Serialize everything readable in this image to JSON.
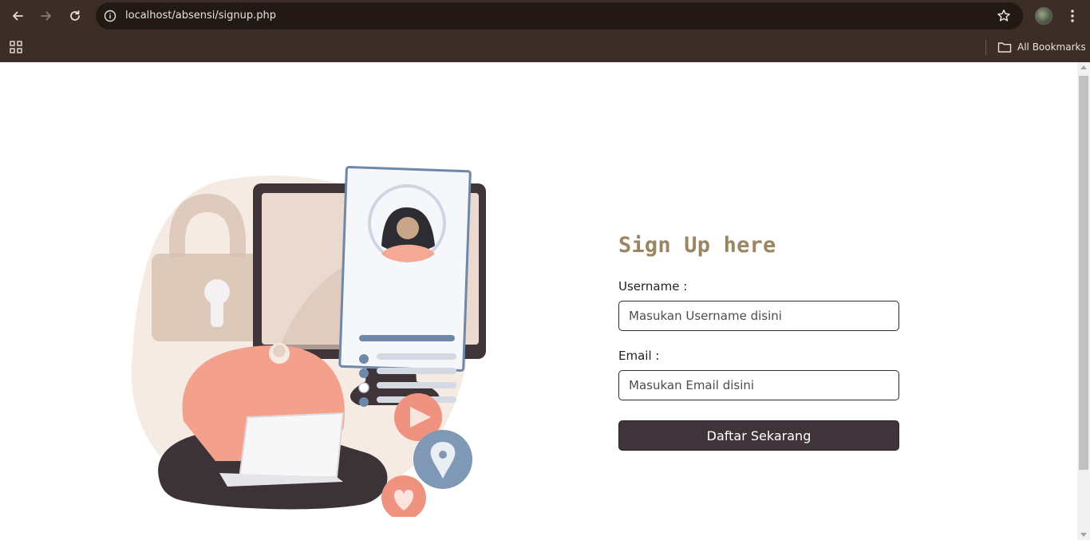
{
  "browser": {
    "url": "localhost/absensi/signup.php",
    "bookmarks_label": "All Bookmarks",
    "back_icon": "arrow-left",
    "forward_icon": "arrow-right",
    "reload_icon": "reload",
    "colors": {
      "chrome": "#3c2d26",
      "omnibox": "#231914"
    }
  },
  "page": {
    "title": "Sign Up here",
    "username_label": "Username :",
    "username_placeholder": "Masukan Username disini",
    "username_value": "",
    "email_label": "Email :",
    "email_placeholder": "Masukan Email disini",
    "email_value": "",
    "submit_label": "Daftar Sekarang",
    "colors": {
      "title": "#9a8663",
      "button": "#3f343a"
    }
  }
}
